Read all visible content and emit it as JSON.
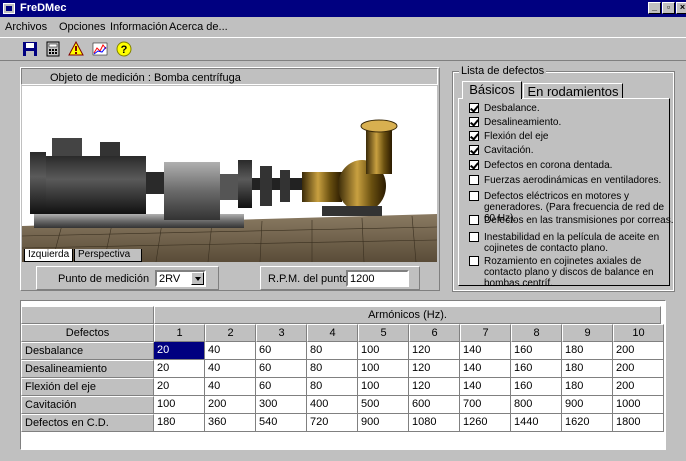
{
  "window": {
    "title": "FreDMec"
  },
  "menu": [
    "Archivos",
    "Opciones",
    "Información",
    "Acerca de..."
  ],
  "toolbar": [
    "save-icon",
    "calculator-icon",
    "warning-icon",
    "chart-icon",
    "help-icon"
  ],
  "object": {
    "label": "Objeto de medición :",
    "value": "Bomba centrífuga"
  },
  "view_tabs": [
    "Izquierda",
    "Perspectiva"
  ],
  "measure_point": {
    "label": "Punto de medición",
    "value": "2RV"
  },
  "rpm": {
    "label": "R.P.M. del punto",
    "value": "1200"
  },
  "defects_group": {
    "title": "Lista de defectos",
    "tabs": [
      "Básicos",
      "En rodamientos"
    ],
    "items": [
      {
        "label": "Desbalance.",
        "checked": true
      },
      {
        "label": "Desalineamiento.",
        "checked": true
      },
      {
        "label": "Flexión del eje",
        "checked": true
      },
      {
        "label": "Cavitación.",
        "checked": true
      },
      {
        "label": "Defectos en corona dentada.",
        "checked": true
      },
      {
        "label": "Fuerzas aerodinámicas en ventiladores.",
        "checked": false
      },
      {
        "label": "Defectos eléctricos en motores y generadores. (Para frecuencia de red de 60 Hz).",
        "checked": false
      },
      {
        "label": "Defectos en las transmisiones  por correas.",
        "checked": false
      },
      {
        "label": "Inestabilidad en la película de aceite en cojinetes de contacto plano.",
        "checked": false
      },
      {
        "label": "Rozamiento en cojinetes axiales de contacto plano y discos de balance en bombas centríf.",
        "checked": false
      }
    ]
  },
  "table": {
    "group_header": "Armónicos  (Hz).",
    "corner": "Defectos",
    "columns": [
      "1",
      "2",
      "3",
      "4",
      "5",
      "6",
      "7",
      "8",
      "9",
      "10"
    ],
    "rows": [
      {
        "name": "Desbalance",
        "values": [
          "20",
          "40",
          "60",
          "80",
          "100",
          "120",
          "140",
          "160",
          "180",
          "200"
        ]
      },
      {
        "name": "Desalineamiento",
        "values": [
          "20",
          "40",
          "60",
          "80",
          "100",
          "120",
          "140",
          "160",
          "180",
          "200"
        ]
      },
      {
        "name": "Flexión del eje",
        "values": [
          "20",
          "40",
          "60",
          "80",
          "100",
          "120",
          "140",
          "160",
          "180",
          "200"
        ]
      },
      {
        "name": "Cavitación",
        "values": [
          "100",
          "200",
          "300",
          "400",
          "500",
          "600",
          "700",
          "800",
          "900",
          "1000"
        ]
      },
      {
        "name": "Defectos en C.D.",
        "values": [
          "180",
          "360",
          "540",
          "720",
          "900",
          "1080",
          "1260",
          "1440",
          "1620",
          "1800"
        ]
      }
    ]
  }
}
